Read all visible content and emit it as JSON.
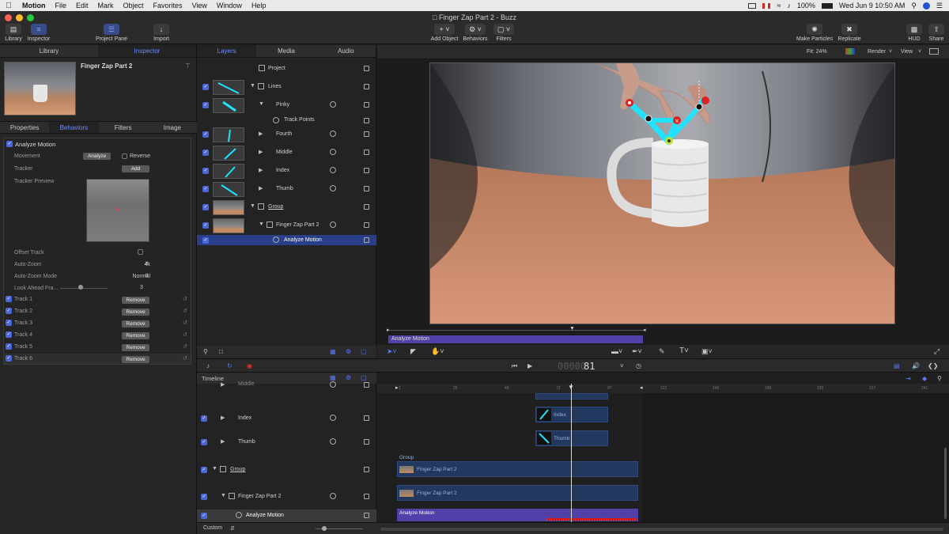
{
  "menubar": {
    "app_name": "Motion",
    "items": [
      "File",
      "Edit",
      "Mark",
      "Object",
      "Favorites",
      "View",
      "Window",
      "Help"
    ],
    "battery": "100%",
    "datetime": "Wed Jun 9  10:50 AM"
  },
  "window": {
    "title": "Finger Zap Part 2 - Buzz"
  },
  "toolbar": {
    "library": "Library",
    "inspector": "Inspector",
    "project_pane": "Project Pane",
    "import": "Import",
    "add_object": "Add Object",
    "behaviors": "Behaviors",
    "filters": "Filters",
    "make_particles": "Make Particles",
    "replicate": "Replicate",
    "hud": "HUD",
    "share": "Share"
  },
  "left_panel": {
    "tabs": [
      "Library",
      "Inspector"
    ],
    "preview_title": "Finger Zap Part 2",
    "subtabs": [
      "Properties",
      "Behaviors",
      "Filters",
      "Image"
    ],
    "behavior_name": "Analyze Motion",
    "movement_label": "Movement",
    "analyze_button": "Analyze",
    "reverse_label": "Reverse",
    "tracker_label": "Tracker",
    "add_button": "Add",
    "tracker_preview_label": "Tracker Preview",
    "offset_track_label": "Offset Track",
    "auto_zoom_label": "Auto-Zoom",
    "auto_zoom_value": "4x",
    "auto_zoom_mode_label": "Auto-Zoom Mode",
    "auto_zoom_mode_value": "Normal",
    "look_ahead_label": "Look Ahead Fra...",
    "look_ahead_value": "3",
    "tracks": [
      "Track 1",
      "Track 2",
      "Track 3",
      "Track 4",
      "Track 5",
      "Track 6"
    ],
    "remove_button": "Remove"
  },
  "layers_panel": {
    "tabs": [
      "Layers",
      "Media",
      "Audio"
    ],
    "rows": [
      "Project",
      "Lines",
      "Pinky",
      "Track Points",
      "Fourth",
      "Middle",
      "Index",
      "Thumb",
      "Group",
      "Finger Zap Part 2",
      "Analyze Motion"
    ]
  },
  "canvas": {
    "fit": "Fit: 24%",
    "render": "Render",
    "view": "View"
  },
  "mini_timeline": {
    "label": "Analyze Motion"
  },
  "transport": {
    "timecode_dim": "00000",
    "timecode": "81"
  },
  "timeline": {
    "title": "Timeline",
    "list_rows": [
      "Middle",
      "Index",
      "Thumb",
      "Group",
      "Finger Zap Part 2",
      "Analyze Motion"
    ],
    "ruler_ticks": [
      "1",
      "25",
      "49",
      "73",
      "97",
      "121",
      "145",
      "169",
      "193",
      "217",
      "241"
    ],
    "clips": {
      "index": "Index",
      "thumb": "Thumb",
      "group_label": "Group",
      "fz1": "Finger Zap Part 2",
      "fz2": "Finger Zap Part 2",
      "analyze": "Analyze Motion"
    },
    "custom": "Custom"
  },
  "colors": {
    "accent": "#5b78f0",
    "cyan_line": "#1fe3ff",
    "analyze_bar": "#5140a8"
  }
}
